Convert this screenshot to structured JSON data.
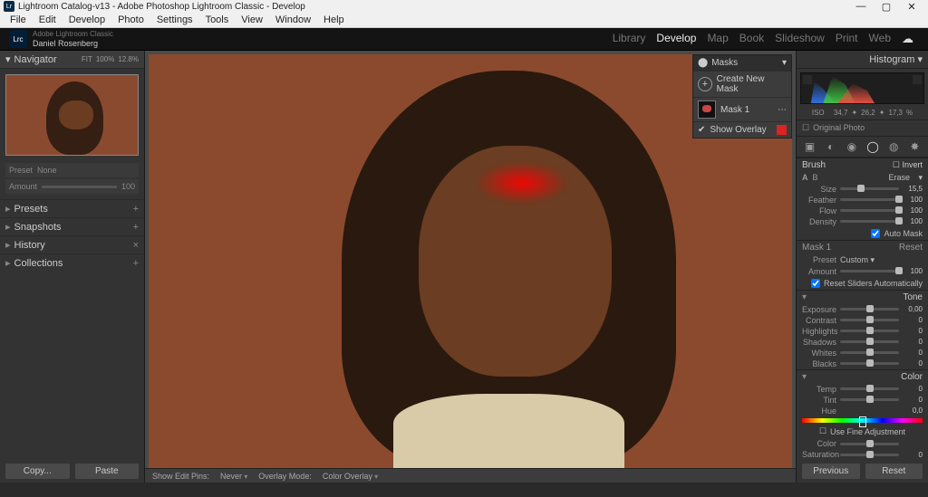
{
  "titlebar": {
    "text": "Lightroom Catalog-v13 - Adobe Photoshop Lightroom Classic - Develop",
    "app_icon": "Lr"
  },
  "menu": [
    "File",
    "Edit",
    "Develop",
    "Photo",
    "Settings",
    "Tools",
    "View",
    "Window",
    "Help"
  ],
  "identity": {
    "product": "Adobe Lightroom Classic",
    "user": "Daniel Rosenberg",
    "lrc": "Lrc"
  },
  "modules": {
    "items": [
      "Library",
      "Develop",
      "Map",
      "Book",
      "Slideshow",
      "Print",
      "Web"
    ],
    "active": 1
  },
  "left": {
    "navigator": {
      "title": "Navigator",
      "mode": "FIT",
      "zoom1": "100%",
      "zoom2": "12.8%"
    },
    "presetbar": {
      "preset_lbl": "Preset",
      "preset_val": "None",
      "amount_lbl": "Amount",
      "amount_val": "100"
    },
    "sections": [
      {
        "name": "Presets",
        "expandable": true,
        "closable": false
      },
      {
        "name": "Snapshots",
        "expandable": true,
        "closable": false
      },
      {
        "name": "History",
        "expandable": false,
        "closable": true
      },
      {
        "name": "Collections",
        "expandable": true,
        "closable": false
      }
    ],
    "buttons": {
      "copy": "Copy...",
      "paste": "Paste"
    }
  },
  "masks": {
    "title": "Masks",
    "create": "Create New Mask",
    "mask1": "Mask 1",
    "show_overlay": "Show Overlay"
  },
  "center_footer": {
    "show_edit_pins": "Show Edit Pins:",
    "show_edit_pins_value": "Never",
    "overlay_mode": "Overlay Mode:",
    "overlay_mode_value": "Color Overlay"
  },
  "right": {
    "histogram_title": "Histogram",
    "hist_readout": {
      "iso_lbl": "ISO",
      "iso": "34,7",
      "f_lbl": "",
      "f": "26,2",
      "mm_lbl": "",
      "mm": "17,3",
      "pct": "%"
    },
    "original": "Original Photo",
    "brush": {
      "title": "Brush",
      "invert": "Invert",
      "a": "A",
      "b": "B",
      "erase": "Erase",
      "sliders": [
        {
          "label": "Size",
          "value": "15,5",
          "pos": 35
        },
        {
          "label": "Feather",
          "value": "100",
          "pos": 100
        },
        {
          "label": "Flow",
          "value": "100",
          "pos": 100
        },
        {
          "label": "Density",
          "value": "100",
          "pos": 100
        }
      ],
      "automask": "Auto Mask"
    },
    "mask_section": {
      "title": "Mask 1",
      "reset": "Reset",
      "preset_lbl": "Preset",
      "preset_val": "Custom ▾",
      "amount_lbl": "Amount",
      "amount_val": "100",
      "reset_auto": "Reset Sliders Automatically"
    },
    "tone": {
      "title": "Tone",
      "sliders": [
        {
          "label": "Exposure",
          "value": "0,00",
          "pos": 50
        },
        {
          "label": "Contrast",
          "value": "0",
          "pos": 50
        },
        {
          "label": "Highlights",
          "value": "0",
          "pos": 50
        },
        {
          "label": "Shadows",
          "value": "0",
          "pos": 50
        },
        {
          "label": "Whites",
          "value": "0",
          "pos": 50
        },
        {
          "label": "Blacks",
          "value": "0",
          "pos": 50
        }
      ]
    },
    "color": {
      "title": "Color",
      "sliders": [
        {
          "label": "Temp",
          "value": "0",
          "pos": 50
        },
        {
          "label": "Tint",
          "value": "0",
          "pos": 50
        }
      ],
      "hue": "Hue",
      "hue_val": "0,0",
      "fine": "Use Fine Adjustment",
      "extra": [
        {
          "label": "Color",
          "value": "",
          "pos": 50
        },
        {
          "label": "Saturation",
          "value": "0",
          "pos": 50
        }
      ]
    },
    "buttons": {
      "prev": "Previous",
      "reset": "Reset"
    }
  }
}
